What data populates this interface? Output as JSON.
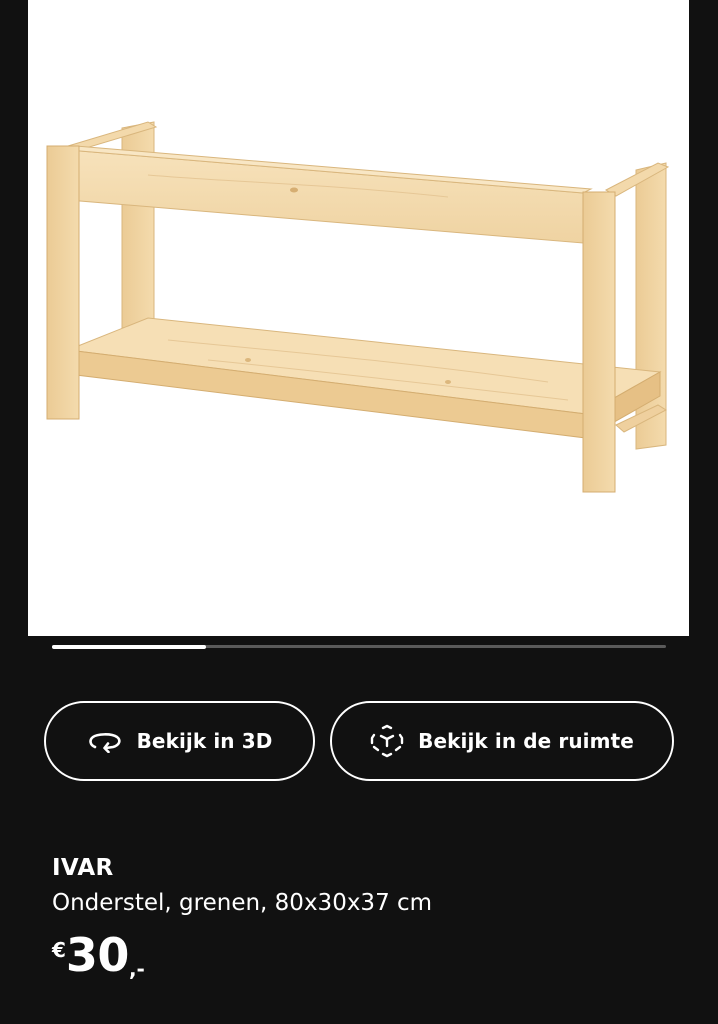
{
  "gallery": {
    "carousel_progress": 0.25
  },
  "actions": {
    "view_3d_label": "Bekijk in 3D",
    "view_in_room_label": "Bekijk in de ruimte"
  },
  "product": {
    "name": "IVAR",
    "description": "Onderstel, grenen, 80x30x37 cm",
    "price": {
      "currency": "€",
      "amount": "30",
      "suffix": ",-"
    }
  },
  "colors": {
    "background": "#111111",
    "foreground": "#ffffff",
    "wood": "#f2d6a6"
  }
}
